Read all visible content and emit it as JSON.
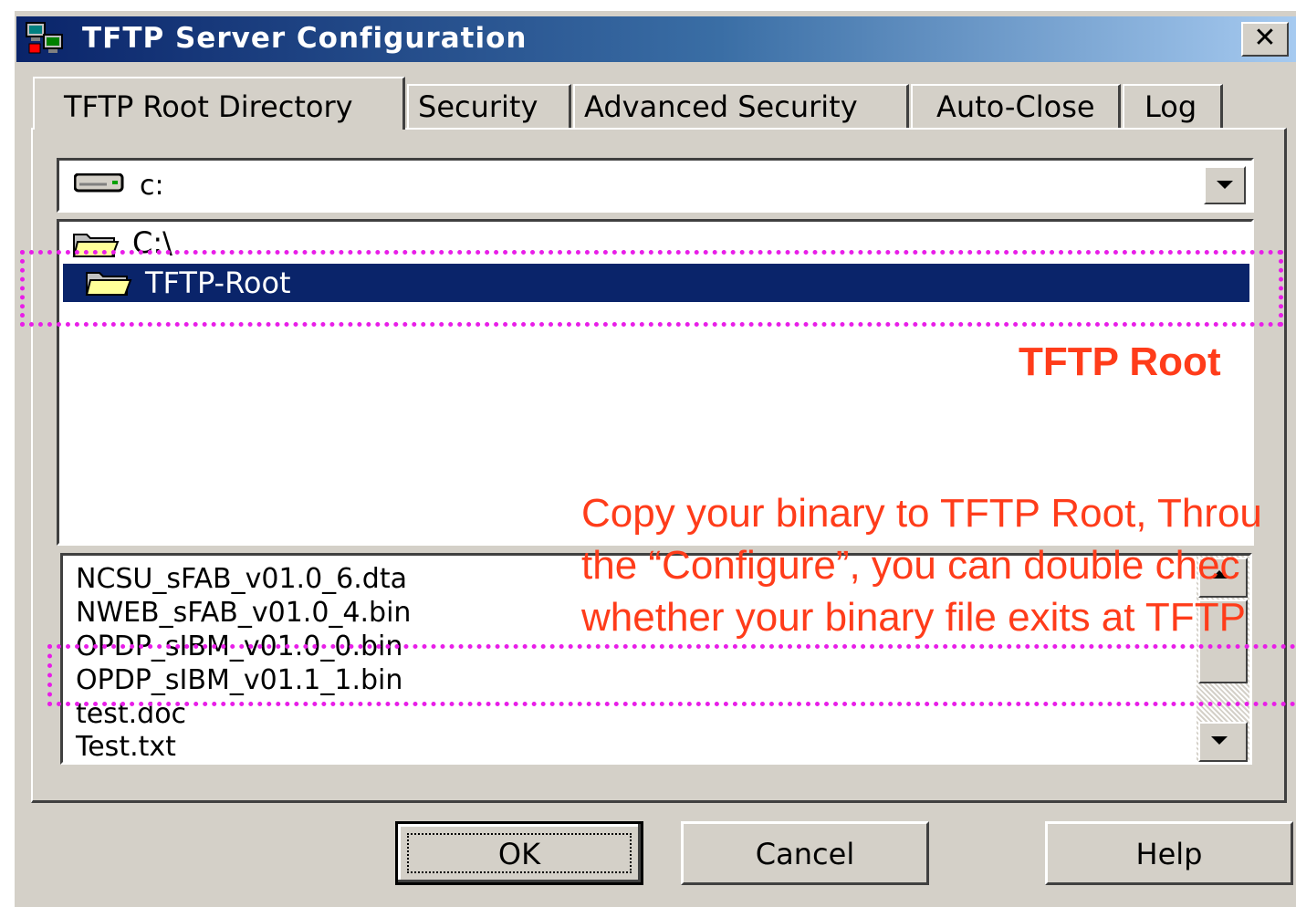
{
  "window": {
    "title": "TFTP Server Configuration",
    "close_label": "✕"
  },
  "tabs": [
    {
      "label": "TFTP Root Directory",
      "active": true
    },
    {
      "label": "Security",
      "active": false
    },
    {
      "label": "Advanced Security",
      "active": false
    },
    {
      "label": "Auto-Close",
      "active": false
    },
    {
      "label": "Log",
      "active": false
    }
  ],
  "drive": {
    "value": "c:"
  },
  "directories": [
    {
      "label": "C:\\",
      "selected": false
    },
    {
      "label": "TFTP-Root",
      "selected": true
    }
  ],
  "files": [
    "NCSU_sFAB_v01.0_6.dta",
    "NWEB_sFAB_v01.0_4.bin",
    "OPDP_sIBM_v01.0_0.bin",
    "OPDP_sIBM_v01.1_1.bin",
    "test.doc",
    "Test.txt"
  ],
  "buttons": {
    "ok": "OK",
    "cancel": "Cancel",
    "help": "Help"
  },
  "annotations": {
    "root_label": "TFTP Root",
    "note_lines": [
      "Copy your binary to TFTP Root, Throu",
      "the “Configure”, you can double chec",
      "whether your binary file exits at TFTP"
    ],
    "color": "#ff3c1a",
    "highlight_color": "#e81ee8"
  }
}
